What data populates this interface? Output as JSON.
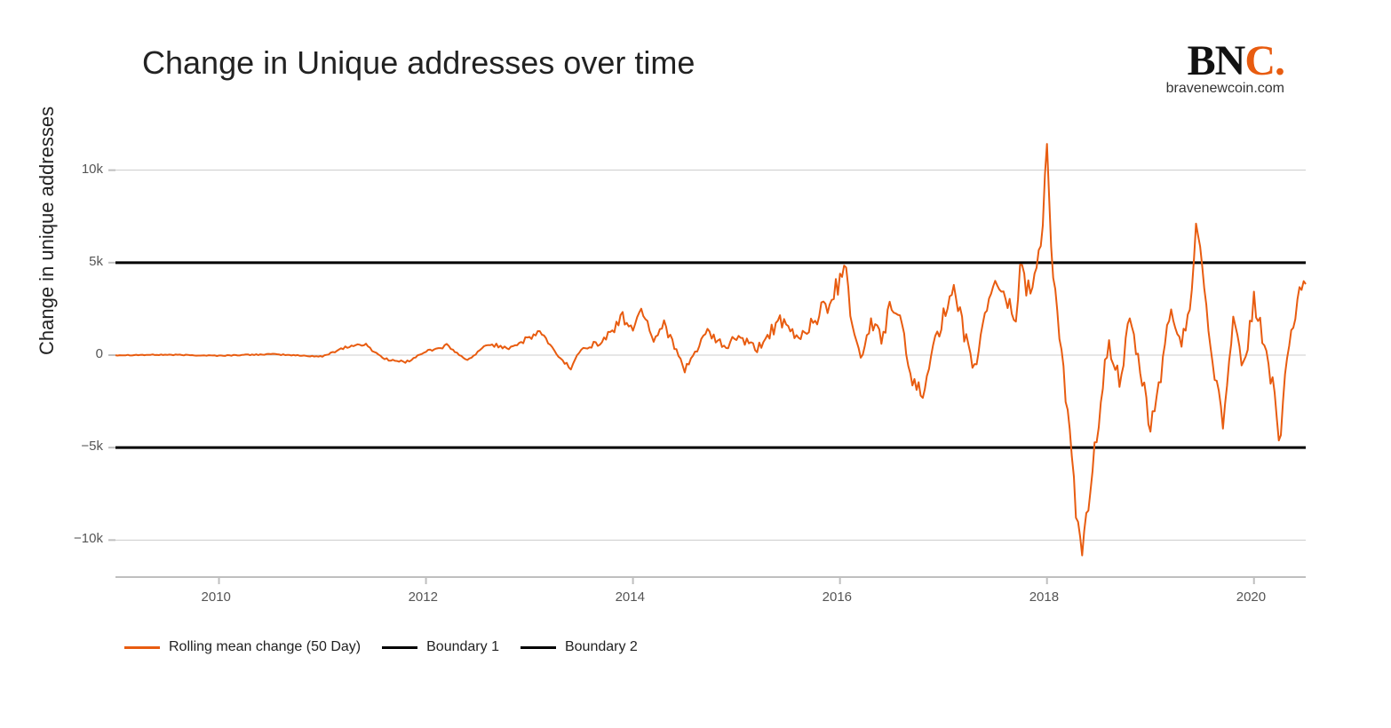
{
  "brand": {
    "name": "BNC",
    "subtext": "bravenewcoin.com"
  },
  "chart_data": {
    "type": "line",
    "title": "Change in Unique addresses over time",
    "ylabel": "Change in unique addresses",
    "xlabel": "",
    "xlim": [
      2009,
      2020.5
    ],
    "ylim": [
      -12000,
      12000
    ],
    "xticks": [
      2010,
      2012,
      2014,
      2016,
      2018,
      2020
    ],
    "yticks": [
      -10000,
      -5000,
      0,
      5000,
      10000
    ],
    "ytick_labels": [
      "−10k",
      "−5k",
      "0",
      "5k",
      "10k"
    ],
    "colors": {
      "rolling": "#e85c10",
      "boundary": "#000000",
      "grid": "#cccccc",
      "axis": "#bfbfbf"
    },
    "series": [
      {
        "name": "Rolling mean change (50 Day)",
        "x": [
          2009.0,
          2009.5,
          2010.0,
          2010.5,
          2011.0,
          2011.2,
          2011.4,
          2011.6,
          2011.8,
          2012.0,
          2012.2,
          2012.4,
          2012.6,
          2012.8,
          2013.0,
          2013.1,
          2013.2,
          2013.3,
          2013.4,
          2013.5,
          2013.7,
          2013.9,
          2014.0,
          2014.1,
          2014.2,
          2014.3,
          2014.4,
          2014.5,
          2014.7,
          2014.9,
          2015.0,
          2015.2,
          2015.4,
          2015.6,
          2015.8,
          2015.9,
          2016.0,
          2016.05,
          2016.1,
          2016.2,
          2016.3,
          2016.4,
          2016.5,
          2016.6,
          2016.7,
          2016.8,
          2016.9,
          2017.0,
          2017.1,
          2017.2,
          2017.3,
          2017.4,
          2017.5,
          2017.6,
          2017.7,
          2017.75,
          2017.8,
          2017.9,
          2017.95,
          2018.0,
          2018.02,
          2018.05,
          2018.1,
          2018.15,
          2018.2,
          2018.25,
          2018.3,
          2018.35,
          2018.4,
          2018.45,
          2018.5,
          2018.55,
          2018.6,
          2018.7,
          2018.8,
          2018.9,
          2019.0,
          2019.1,
          2019.2,
          2019.3,
          2019.4,
          2019.45,
          2019.5,
          2019.55,
          2019.6,
          2019.7,
          2019.8,
          2019.9,
          2020.0,
          2020.1,
          2020.2,
          2020.25,
          2020.3,
          2020.4,
          2020.5
        ],
        "values": [
          0,
          20,
          -30,
          50,
          -80,
          400,
          600,
          -200,
          -400,
          200,
          500,
          -300,
          600,
          400,
          900,
          1300,
          500,
          -200,
          -700,
          400,
          700,
          2000,
          1500,
          2500,
          800,
          1800,
          500,
          -900,
          1200,
          400,
          1000,
          300,
          1800,
          900,
          2200,
          3000,
          4000,
          5500,
          2500,
          -300,
          1800,
          900,
          2800,
          1400,
          -1500,
          -2400,
          800,
          2000,
          3200,
          1200,
          -900,
          2200,
          4200,
          3000,
          2000,
          5200,
          3500,
          4500,
          6500,
          11500,
          8500,
          5000,
          2000,
          -500,
          -3000,
          -6500,
          -9500,
          -10500,
          -8000,
          -5500,
          -3500,
          -1000,
          500,
          -1500,
          1800,
          -800,
          -4000,
          -1000,
          2500,
          500,
          3500,
          7500,
          5000,
          2500,
          -500,
          -3500,
          1500,
          -800,
          3000,
          500,
          -2000,
          -5000,
          -1500,
          2500,
          4000
        ]
      },
      {
        "name": "Boundary 1",
        "constant": 5000
      },
      {
        "name": "Boundary 2",
        "constant": -5000
      }
    ]
  }
}
